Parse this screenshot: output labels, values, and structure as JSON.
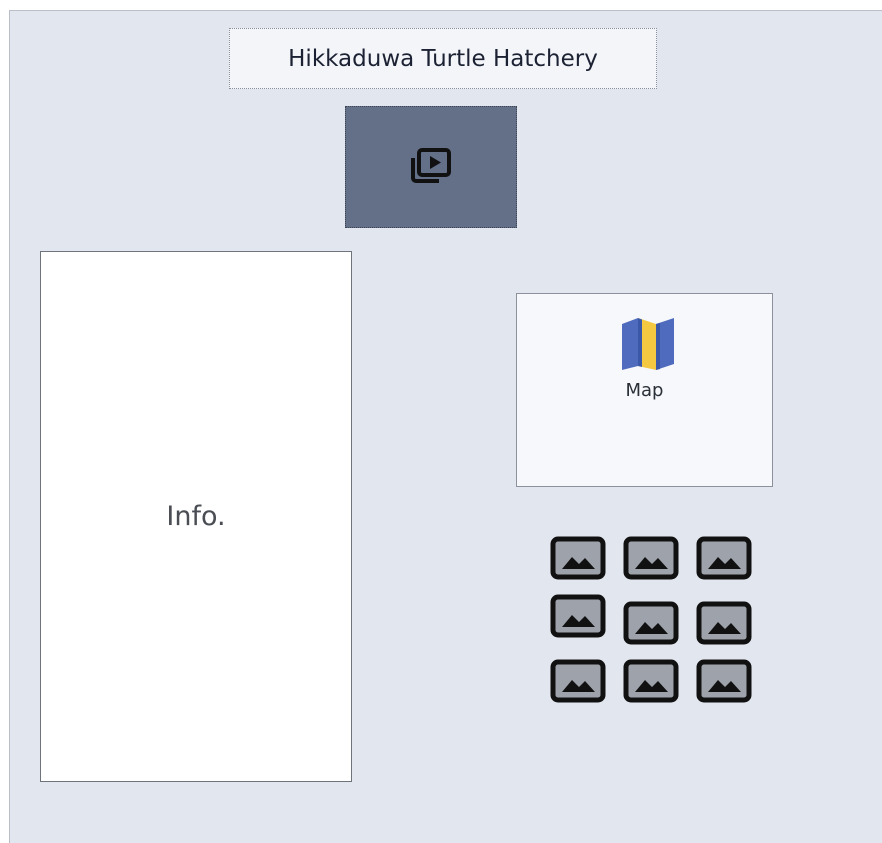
{
  "header": {
    "title": "Hikkaduwa Turtle Hatchery"
  },
  "video_button": {
    "icon": "video-library-icon"
  },
  "info_panel": {
    "label": "Info."
  },
  "map_card": {
    "icon": "folded-map-icon",
    "label": "Map"
  },
  "gallery": {
    "icon": "image-icon",
    "count_label": ""
  },
  "colors": {
    "canvas_bg": "#e2e6ee",
    "title_bg": "#f3f5f9",
    "video_bg": "#647087",
    "map_blue": "#4f6bbd",
    "map_yellow": "#f5c842",
    "thumb_border": "#111111",
    "thumb_fill": "#9ea3ab"
  }
}
